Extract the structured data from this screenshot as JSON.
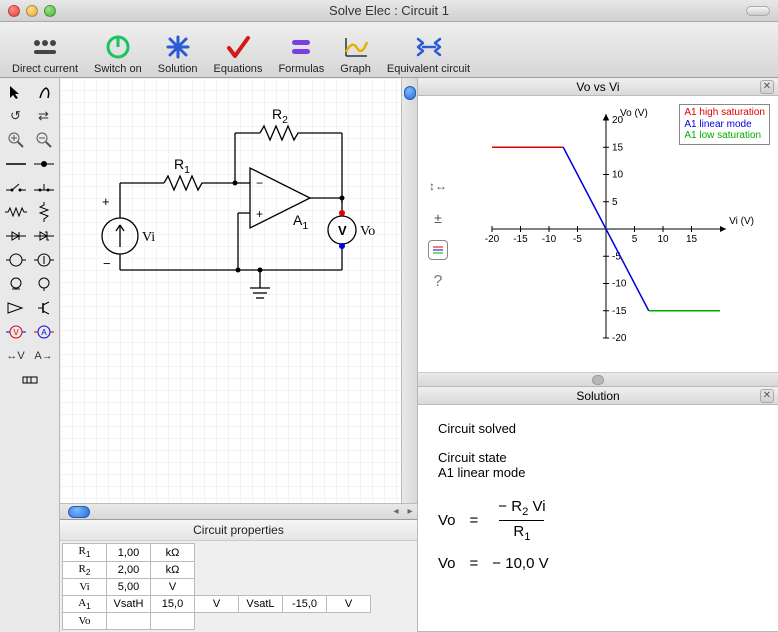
{
  "window": {
    "title": "Solve Elec : Circuit 1"
  },
  "toolbar": {
    "direct_current": "Direct current",
    "switch_on": "Switch on",
    "solution": "Solution",
    "equations": "Equations",
    "formulas": "Formulas",
    "graph": "Graph",
    "equiv": "Equivalent circuit"
  },
  "schematic": {
    "r1": "R",
    "r1_sub": "1",
    "r2": "R",
    "r2_sub": "2",
    "a1": "A",
    "a1_sub": "1",
    "vi": "Vi",
    "vo": "Vo",
    "v_meter": "V"
  },
  "props_header": "Circuit properties",
  "props_rows": [
    {
      "name": "R",
      "sub": "1",
      "c2": "1,00",
      "c3": "kΩ",
      "c4": "",
      "c5": "",
      "c6": "",
      "c7": ""
    },
    {
      "name": "R",
      "sub": "2",
      "c2": "2,00",
      "c3": "kΩ",
      "c4": "",
      "c5": "",
      "c6": "",
      "c7": ""
    },
    {
      "name": "Vi",
      "sub": "",
      "c2": "5,00",
      "c3": "V",
      "c4": "",
      "c5": "",
      "c6": "",
      "c7": ""
    },
    {
      "name": "A",
      "sub": "1",
      "c2": "VsatH",
      "c3": "15,0",
      "c4": "V",
      "c5": "VsatL",
      "c6": "-15,0",
      "c7": "V"
    },
    {
      "name": "Vo",
      "sub": "",
      "c2": "",
      "c3": "",
      "c4": "",
      "c5": "",
      "c6": "",
      "c7": ""
    }
  ],
  "graph": {
    "title": "Vo vs Vi",
    "y_label": "Vo (V)",
    "x_label": "Vi (V)",
    "legend": {
      "high": "A1 high saturation",
      "linear": "A1 linear mode",
      "low": "A1 low saturation"
    }
  },
  "solution": {
    "title": "Solution",
    "line1": "Circuit solved",
    "line2": "Circuit state",
    "line3": "A1 linear mode",
    "eq_lhs": "Vo",
    "eq_eq": "=",
    "eq_num_minus": "−",
    "eq_num_r": "R",
    "eq_num_r_sub": "2",
    "eq_num_vi": " Vi",
    "eq_den_r": "R",
    "eq_den_r_sub": "1",
    "res_lhs": "Vo",
    "res_eq": "=",
    "res_val": "−  10,0 V"
  },
  "chart_data": {
    "type": "line",
    "title": "Vo vs Vi",
    "xlabel": "Vi (V)",
    "ylabel": "Vo (V)",
    "xlim": [
      -20,
      20
    ],
    "ylim": [
      -20,
      20
    ],
    "x_ticks": [
      -20,
      -15,
      -10,
      -5,
      0,
      5,
      10,
      15
    ],
    "y_ticks": [
      -20,
      -15,
      -10,
      -5,
      5,
      10,
      15,
      20
    ],
    "series": [
      {
        "name": "A1 high saturation",
        "color": "#e00000",
        "x": [
          -20,
          -7.5
        ],
        "y": [
          15,
          15
        ]
      },
      {
        "name": "A1 linear mode",
        "color": "#0000dd",
        "x": [
          -7.5,
          7.5
        ],
        "y": [
          15,
          -15
        ]
      },
      {
        "name": "A1 low saturation",
        "color": "#00aa00",
        "x": [
          7.5,
          20
        ],
        "y": [
          -15,
          -15
        ]
      }
    ]
  }
}
